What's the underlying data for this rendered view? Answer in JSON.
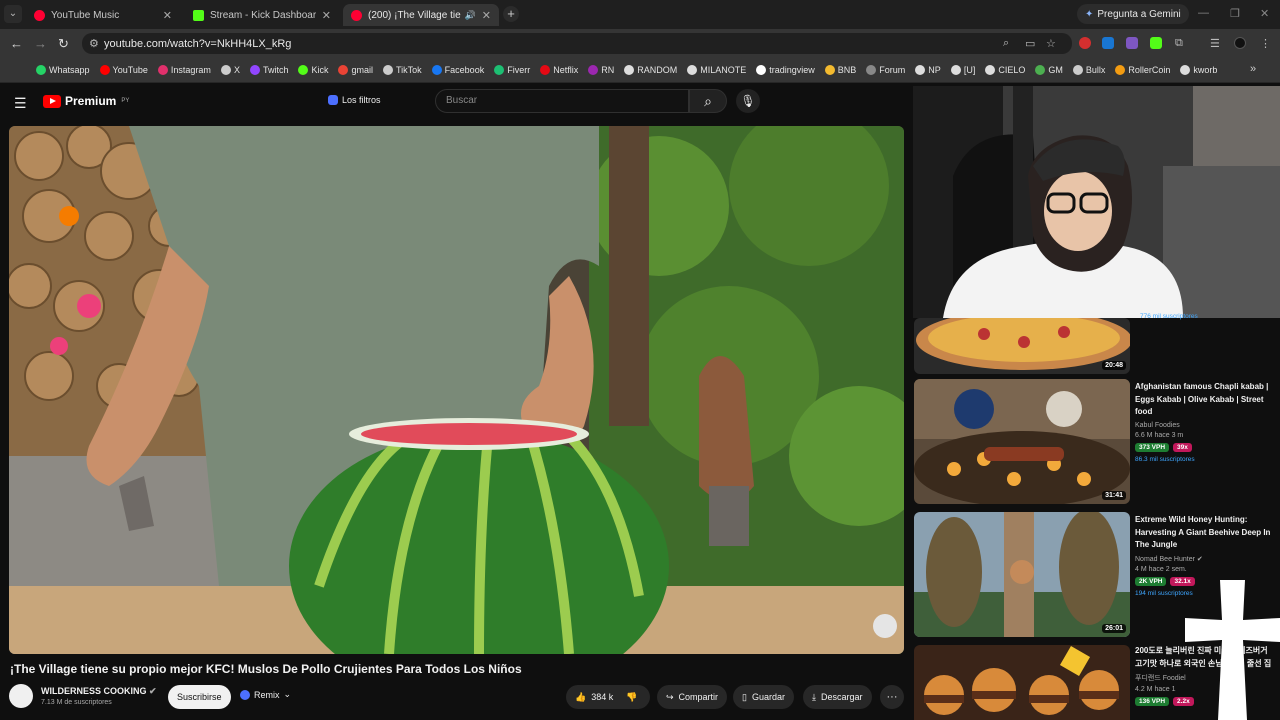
{
  "browser": {
    "tabs": [
      {
        "title": "YouTube Music",
        "color": "#ff0033"
      },
      {
        "title": "Stream - Kick Dashboard",
        "color": "#53fc18"
      },
      {
        "title": "(200) ¡The Village tiene su p",
        "color": "#ff0033"
      }
    ],
    "gemini_label": "Pregunta a Gemini",
    "url": "youtube.com/watch?v=NkHH4LX_kRg",
    "bookmarks": [
      "Whatsapp",
      "YouTube",
      "Instagram",
      "X",
      "Twitch",
      "Kick",
      "gmail",
      "TikTok",
      "Facebook",
      "Fiverr",
      "Netflix",
      "RN",
      "RANDOM",
      "MILANOTE",
      "tradingview",
      "BNB",
      "Forum",
      "NP",
      "[U]",
      "CIELO",
      "GM",
      "Bullx",
      "RollerCoin",
      "kworb"
    ]
  },
  "youtube": {
    "logo": "Premium",
    "logo_region": "PY",
    "filters_label": "Los filtros",
    "search_placeholder": "Buscar",
    "video": {
      "title": "¡The Village tiene su propio mejor KFC! Muslos De Pollo Crujientes Para Todos Los Niños",
      "channel": "WILDERNESS COOKING",
      "subscribers": "7.13 M de suscriptores",
      "subscribe_label": "Suscribirse",
      "remix_label": "Remix",
      "likes": "384 k",
      "share_label": "Compartir",
      "save_label": "Guardar",
      "download_label": "Descargar"
    },
    "recommendations": [
      {
        "duration": "20:48",
        "partial_subscribers": "776 mil suscriptores"
      },
      {
        "title": "Afghanistan famous Chapli kabab | Eggs Kabab | Olive Kabab | Street food",
        "channel": "Kabul Foodies",
        "stats": "6.6 M  hace 3 m",
        "vph": "373 VPH",
        "mult": "39x",
        "subs": "86.3 mil suscriptores",
        "duration": "31:41"
      },
      {
        "title": "Extreme Wild Honey Hunting: Harvesting A Giant Beehive Deep In The Jungle",
        "channel": "Nomad Bee Hunter",
        "stats": "4 M  hace 2 sem.",
        "vph": "2K VPH",
        "mult": "32.1x",
        "subs": "194 mil suscriptores",
        "duration": "26:01"
      },
      {
        "title": "200도로 늘리버린 진짜 미국식 치즈버거 고기맛 하나로 외국인 손님들까지 줄선 집",
        "channel": "푸디랜드 Foodiel",
        "stats": "4.2 M  hace 1",
        "vph": "136 VPH",
        "mult": "2.2x"
      }
    ]
  },
  "colors": {
    "accent_red": "#ff0000",
    "link_blue": "#3ea6ff",
    "badge_green": "#1e7d32",
    "badge_pink": "#c2185b"
  }
}
